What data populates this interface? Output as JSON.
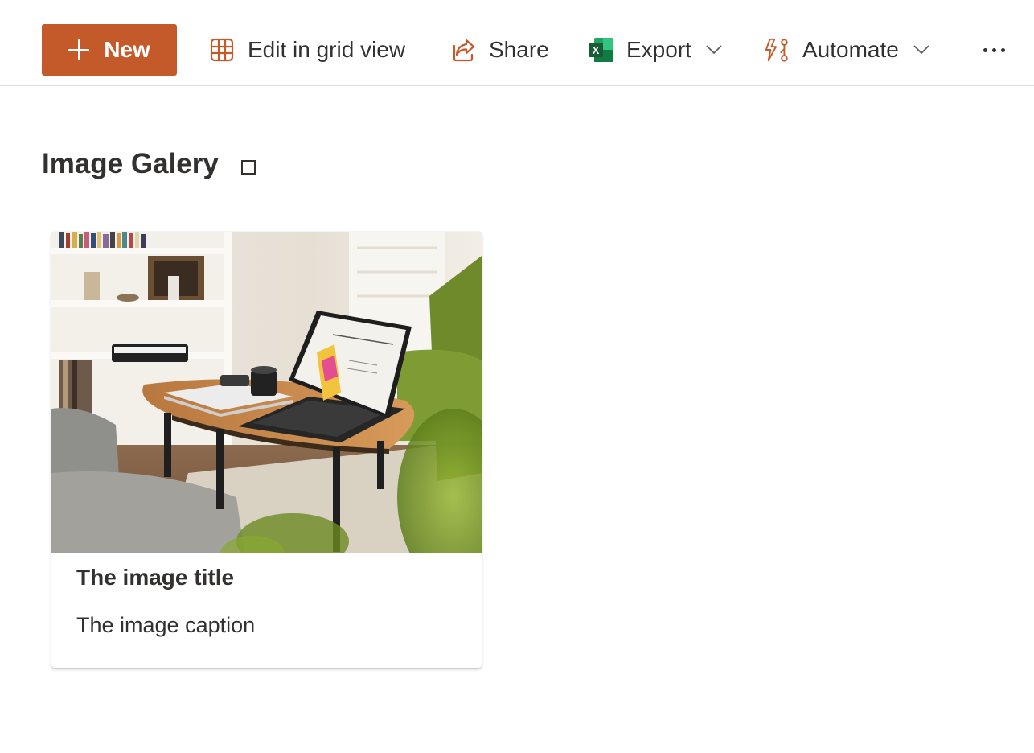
{
  "commandbar": {
    "new_label": "New",
    "edit_grid_label": "Edit in grid view",
    "share_label": "Share",
    "export_label": "Export",
    "automate_label": "Automate",
    "more_icon": "more-horizontal-icon"
  },
  "colors": {
    "accent": "#c4592a",
    "excel_green": "#1d7044",
    "text": "#323130"
  },
  "gallery": {
    "title": "Image Galery"
  },
  "card": {
    "title": "The image title",
    "caption": "The image caption",
    "image_description": "photo"
  }
}
